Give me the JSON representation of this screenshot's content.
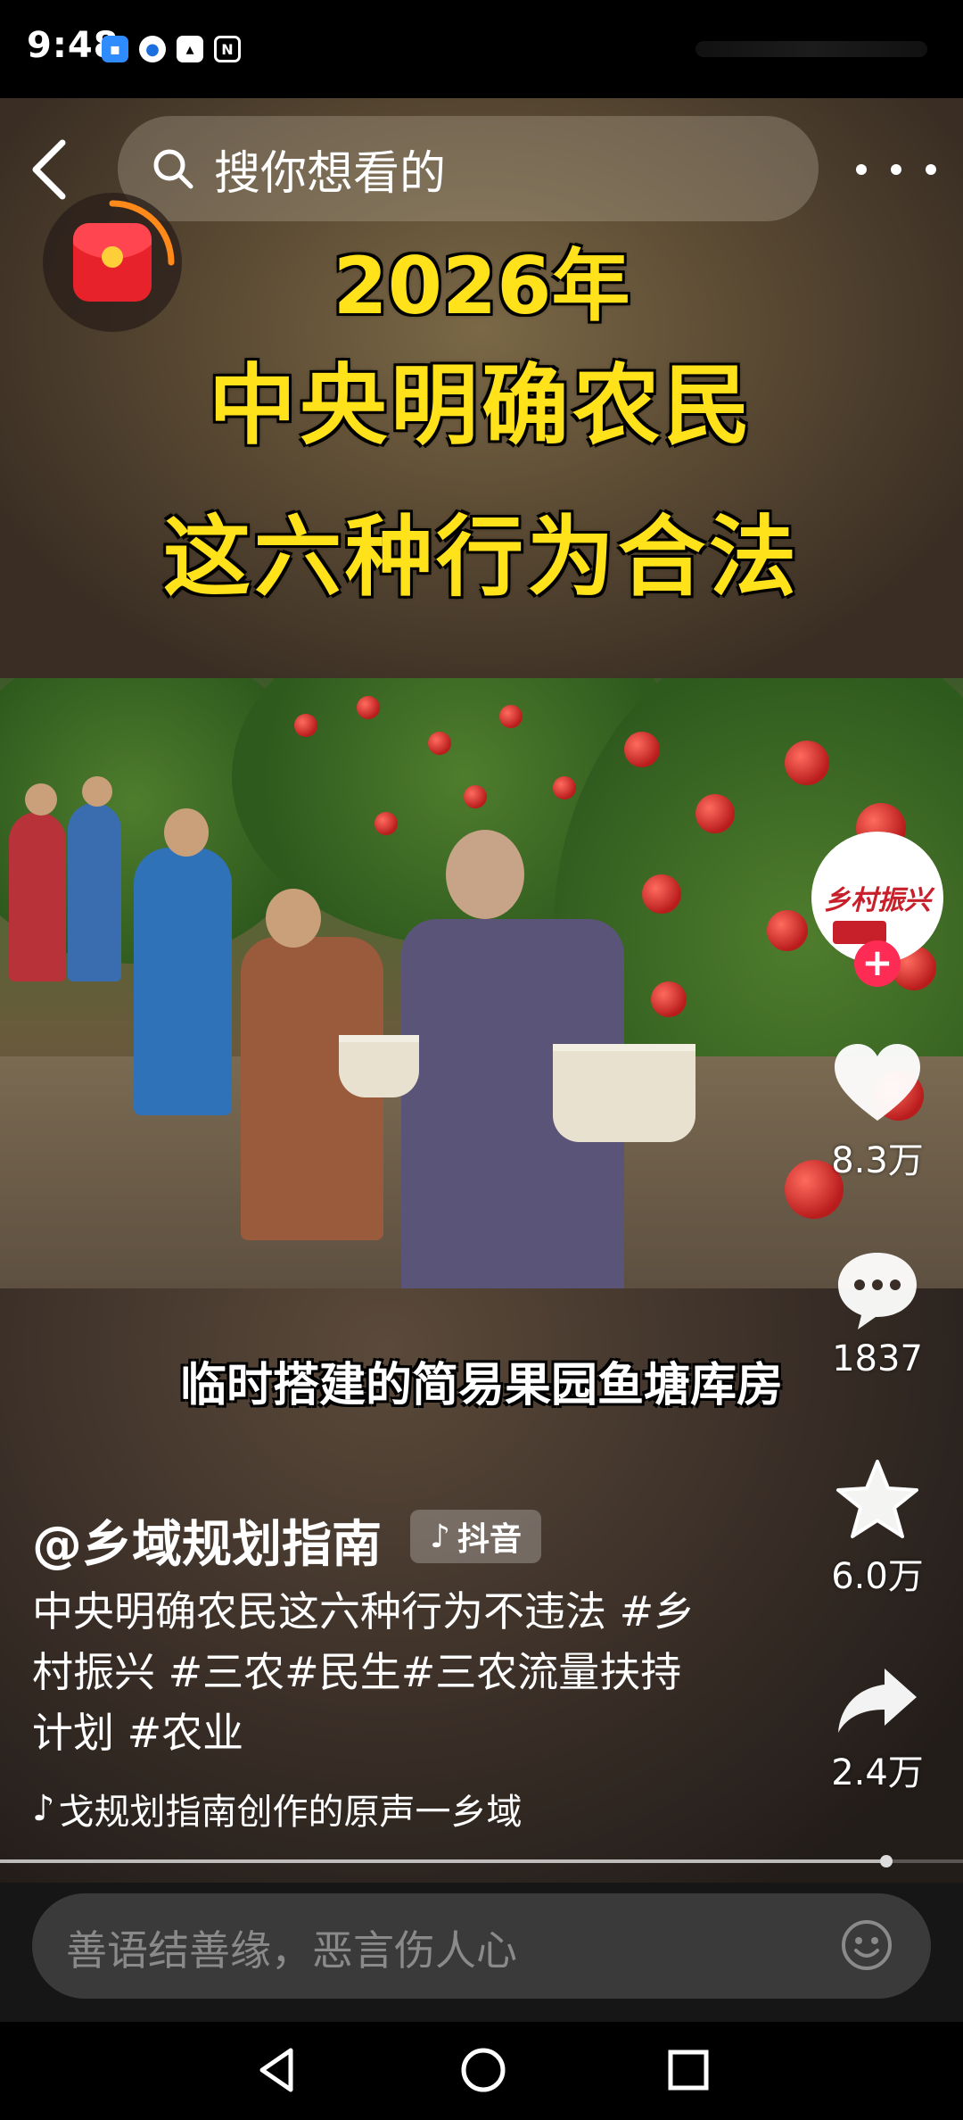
{
  "status_bar": {
    "time": "9:48"
  },
  "top_nav": {
    "search_placeholder": "搜你想看的"
  },
  "video": {
    "headline_lines": [
      "2026年",
      "中央明确农民",
      "这六种行为合法"
    ],
    "subtitle": "临时搭建的简易果园鱼塘库房"
  },
  "creator": {
    "avatar_text": "乡村振兴"
  },
  "actions": {
    "likes": "8.3万",
    "comments": "1837",
    "favorites": "6.0万",
    "shares": "2.4万"
  },
  "post": {
    "author": "@乡域规划指南",
    "platform_badge": "抖音",
    "caption": "中央明确农民这六种行为不违法 #乡村振兴 #三农#民生#三农流量扶持计划 #农业",
    "music": "戈规划指南创作的原声一乡域"
  },
  "playback": {
    "progress": 0.92
  },
  "comment_bar": {
    "placeholder": "善语结善缘，恶言伤人心"
  },
  "icons": [
    "back-icon",
    "search-icon",
    "more-icon",
    "red-packet-icon",
    "heart-icon",
    "comment-icon",
    "star-icon",
    "share-icon",
    "emoji-icon",
    "nav-back-icon",
    "nav-home-icon",
    "nav-recent-icon"
  ],
  "colors": {
    "headline": "#ffe21a",
    "follow": "#fe2c55",
    "avatar_brand": "#c8202a"
  }
}
